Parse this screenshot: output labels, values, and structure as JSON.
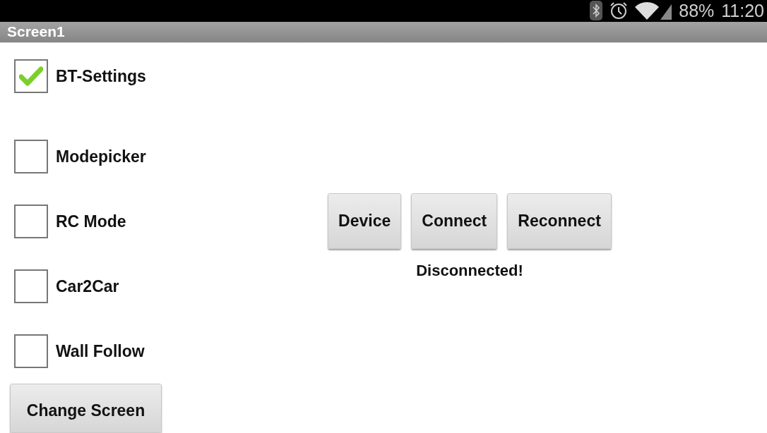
{
  "status_bar": {
    "battery": "88%",
    "time": "11:20"
  },
  "title_bar": {
    "title": "Screen1"
  },
  "checkboxes": [
    {
      "label": "BT-Settings",
      "checked": true
    },
    {
      "label": "Modepicker",
      "checked": false
    },
    {
      "label": "RC Mode",
      "checked": false
    },
    {
      "label": "Car2Car",
      "checked": false
    },
    {
      "label": "Wall Follow",
      "checked": false
    }
  ],
  "change_button": "Change Screen",
  "connection_buttons": [
    "Device",
    "Connect",
    "Reconnect"
  ],
  "connection_status": "Disconnected!"
}
